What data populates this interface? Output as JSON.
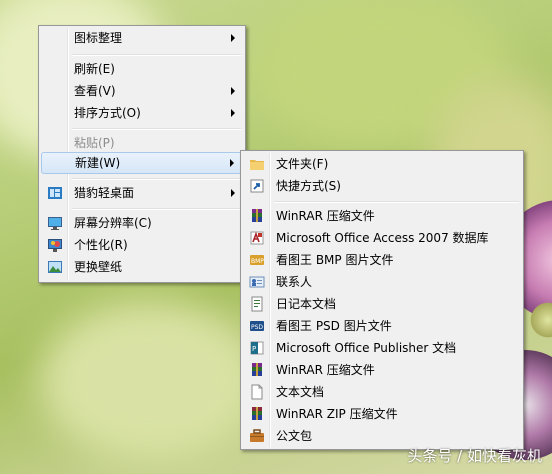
{
  "context_menu": {
    "items": [
      {
        "label": "图标整理",
        "icon": "",
        "submenu": true,
        "state": "normal"
      },
      {
        "label": "刷新(E)",
        "icon": "",
        "submenu": false,
        "state": "normal"
      },
      {
        "label": "查看(V)",
        "icon": "",
        "submenu": true,
        "state": "normal"
      },
      {
        "label": "排序方式(O)",
        "icon": "",
        "submenu": true,
        "state": "normal"
      },
      {
        "label": "粘贴(P)",
        "icon": "",
        "submenu": false,
        "state": "disabled"
      },
      {
        "label": "新建(W)",
        "icon": "",
        "submenu": true,
        "state": "highlighted"
      },
      {
        "label": "猎豹轻桌面",
        "icon": "desktop-app-icon",
        "submenu": true,
        "state": "normal"
      },
      {
        "label": "屏幕分辨率(C)",
        "icon": "monitor-icon",
        "submenu": false,
        "state": "normal"
      },
      {
        "label": "个性化(R)",
        "icon": "personalize-icon",
        "submenu": false,
        "state": "normal"
      },
      {
        "label": "更换壁纸",
        "icon": "wallpaper-icon",
        "submenu": false,
        "state": "normal"
      }
    ]
  },
  "new_submenu": {
    "items": [
      {
        "label": "文件夹(F)",
        "icon": "folder-icon"
      },
      {
        "label": "快捷方式(S)",
        "icon": "shortcut-icon"
      },
      {
        "label": "WinRAR 压缩文件",
        "icon": "winrar-icon"
      },
      {
        "label": "Microsoft Office Access 2007 数据库",
        "icon": "access-icon"
      },
      {
        "label": "看图王 BMP 图片文件",
        "icon": "bmp-icon"
      },
      {
        "label": "联系人",
        "icon": "contact-icon"
      },
      {
        "label": "日记本文档",
        "icon": "journal-icon"
      },
      {
        "label": "看图王 PSD 图片文件",
        "icon": "psd-icon"
      },
      {
        "label": "Microsoft Office Publisher 文档",
        "icon": "publisher-icon"
      },
      {
        "label": "WinRAR 压缩文件",
        "icon": "winrar-icon"
      },
      {
        "label": "文本文档",
        "icon": "text-doc-icon"
      },
      {
        "label": "WinRAR ZIP 压缩文件",
        "icon": "winrar-zip-icon"
      },
      {
        "label": "公文包",
        "icon": "briefcase-icon"
      }
    ]
  },
  "watermark": "头条号 / 如快看灰机",
  "colors": {
    "highlight": "#d6e6f7",
    "menu_bg": "#f0f0f0",
    "disabled_text": "#8d8d8d"
  }
}
